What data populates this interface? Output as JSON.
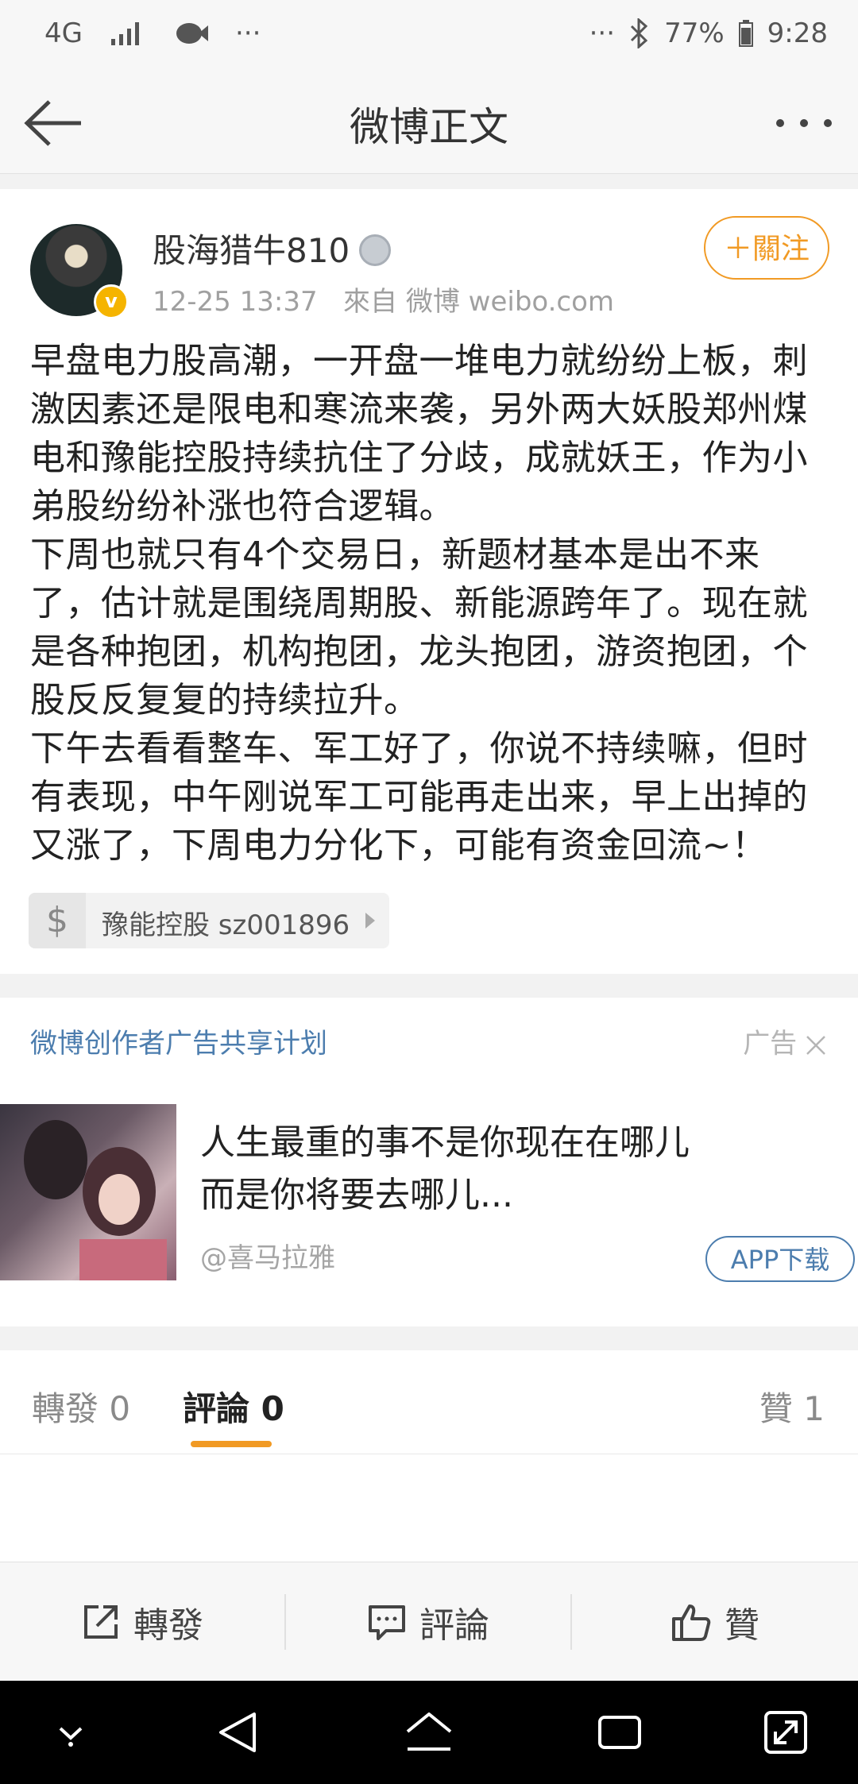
{
  "status_bar": {
    "network": "4G",
    "left_more": "···",
    "right_more": "···",
    "battery": "77%",
    "time": "9:28"
  },
  "nav": {
    "title": "微博正文"
  },
  "post": {
    "username": "股海猎牛810",
    "timestamp": "12-25 13:37",
    "source": "來自 微博 weibo.com",
    "follow_label": "＋關注",
    "verified_badge": "v",
    "text": "早盘电力股高潮，一开盘一堆电力就纷纷上板，刺\n激因素还是限电和寒流来袭，另外两大妖股郑州煤\n电和豫能控股持续抗住了分歧，成就妖王，作为小\n弟股纷纷补涨也符合逻辑。\n下周也就只有4个交易日，新题材基本是出不来\n了，估计就是围绕周期股、新能源跨年了。现在就\n是各种抱团，机构抱团，龙头抱团，游资抱团，个\n股反反复复的持续拉升。\n下午去看看整车、军工好了，你说不持续嘛，但时\n有表现，中午刚说军工可能再走出来，早上出掉的\n又涨了，下周电力分化下，可能有资金回流~！",
    "stock_tag": {
      "symbol": "$",
      "label": "豫能控股 sz001896"
    }
  },
  "ad": {
    "promo_title": "微博创作者广告共享计划",
    "ad_label": "广告",
    "headline_line1": "人生最重的事不是你现在在哪儿",
    "headline_line2": "而是你将要去哪儿...",
    "source": "@喜马拉雅",
    "download_label": "APP下载"
  },
  "tabs": {
    "repost": "轉發 0",
    "comment": "評論 0",
    "like": "贊 1"
  },
  "action_bar": {
    "repost": "轉發",
    "comment": "評論",
    "like": "贊"
  },
  "colors": {
    "accent_orange": "#f19a24",
    "link_blue": "#4c7dae"
  }
}
